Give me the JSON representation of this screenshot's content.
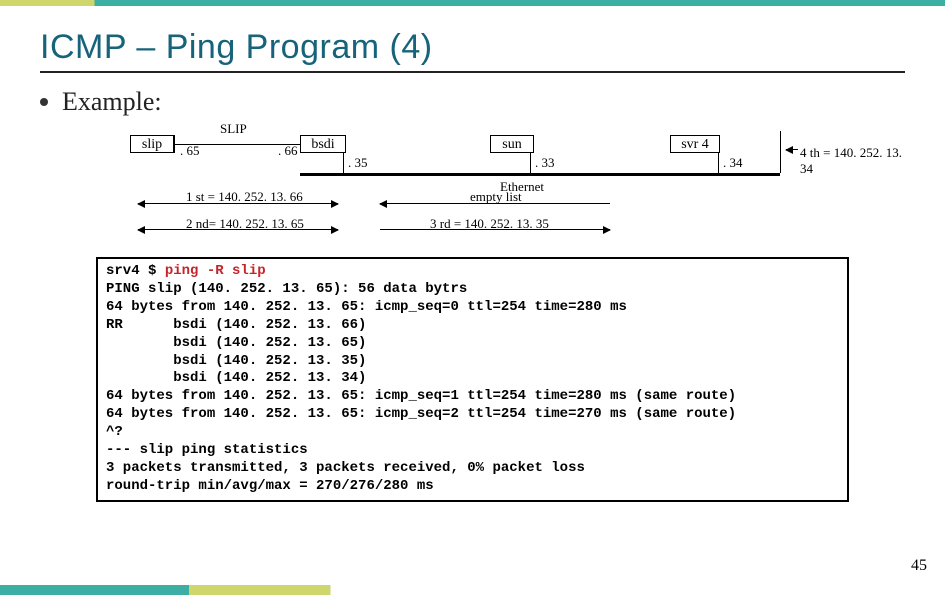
{
  "title": "ICMP – Ping Program (4)",
  "bullet": "Example:",
  "diagram": {
    "nodes": {
      "slip": "slip",
      "bsdi": "bsdi",
      "sun": "sun",
      "svr4": "svr 4"
    },
    "link_label": "SLIP",
    "ips": {
      "slip_side": ". 65",
      "bsdi_left": ". 66",
      "bsdi_right": ". 35",
      "sun_right": ". 33",
      "svr4_right": ". 34"
    },
    "ethernet": "Ethernet",
    "routes": {
      "first": "1 st = 140. 252. 13. 66",
      "second": "2 nd= 140. 252. 13. 65",
      "empty": "empty list",
      "third": "3 rd = 140. 252. 13. 35",
      "fourth": "4 th = 140. 252. 13. 34"
    }
  },
  "terminal": {
    "prompt": "srv4 $ ",
    "cmd": "ping -R slip",
    "lines": [
      "PING slip (140. 252. 13. 65): 56 data bytrs",
      "64 bytes from 140. 252. 13. 65: icmp_seq=0 ttl=254 time=280 ms",
      "RR      bsdi (140. 252. 13. 66)",
      "        bsdi (140. 252. 13. 65)",
      "        bsdi (140. 252. 13. 35)",
      "        bsdi (140. 252. 13. 34)",
      "64 bytes from 140. 252. 13. 65: icmp_seq=1 ttl=254 time=280 ms (same route)",
      "64 bytes from 140. 252. 13. 65: icmp_seq=2 ttl=254 time=270 ms (same route)",
      "^?",
      "--- slip ping statistics",
      "3 packets transmitted, 3 packets received, 0% packet loss",
      "round-trip min/avg/max = 270/276/280 ms"
    ]
  },
  "page_number": "45"
}
